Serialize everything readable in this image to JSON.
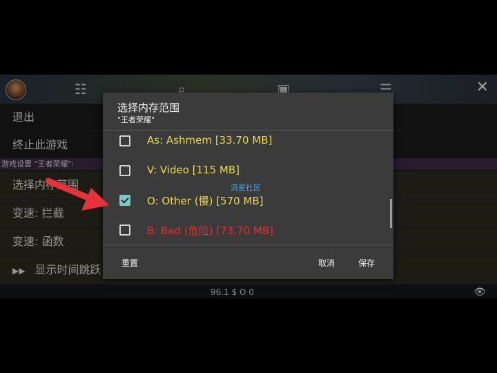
{
  "menu": {
    "exit": "退出",
    "terminate": "终止此游戏",
    "section": "游戏设置 \"王者荣耀\":",
    "select_range": "选择内存范围",
    "speed_intercept": "变速: 拦截",
    "speed_function": "变速: 函数",
    "time_jump": "显示时间跳跃"
  },
  "status": {
    "text": "96.1 $ O 0"
  },
  "dialog": {
    "title": "选择内存范围",
    "subtitle": "\"王者荣耀\"",
    "options": [
      {
        "label": "As: Ashmem [33.70 MB]",
        "checked": false,
        "color": "#e8d84a"
      },
      {
        "label": "V: Video [115 MB]",
        "checked": false,
        "color": "#e8d84a"
      },
      {
        "label": "O: Other (慢) [570 MB]",
        "checked": true,
        "color": "#e8d84a"
      },
      {
        "label": "B: Bad (危险) [73.70 MB]",
        "checked": false,
        "color": "#e03030"
      }
    ],
    "watermark": "流星社区",
    "reset": "重置",
    "cancel": "取消",
    "save": "保存"
  },
  "colors": {
    "checkbox_accent": "#7ec8c3",
    "arrow": "#e8323a"
  },
  "icons": [
    "avatar",
    "sliders-icon",
    "search-icon",
    "save-icon",
    "list-icon",
    "close-icon",
    "eye-icon",
    "fast-forward-icon"
  ]
}
